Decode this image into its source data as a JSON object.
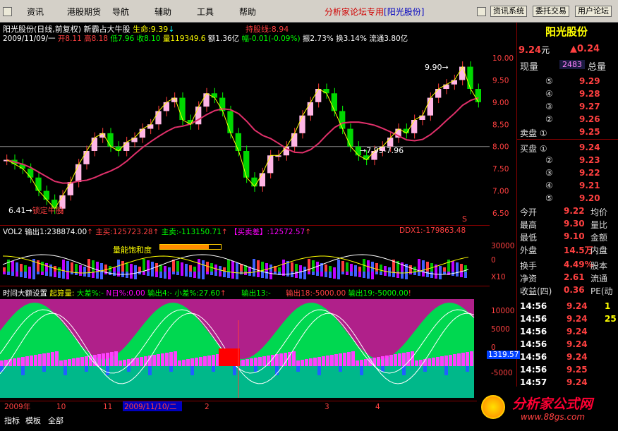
{
  "menu": {
    "items": [
      "资讯",
      "港股期货",
      "导航",
      "辅助",
      "工具",
      "帮助"
    ],
    "banner_main": "分析家论坛专用",
    "banner_stock": "[阳光股份]",
    "sys_buttons": [
      "资讯系统",
      "委托交易",
      "用户论坛"
    ]
  },
  "header": {
    "title": "阳光股份(日线,前复权) 新霸占大牛股",
    "life": "生命:9.39",
    "hold": "持股线:8.94",
    "date": "2009/11/09/一",
    "open_label": "开",
    "open": "8.11",
    "high_label": "高",
    "high": "8.18",
    "low_label": "低",
    "low": "7.96",
    "close_label": "收",
    "close": "8.10",
    "vol_label": "量",
    "vol": "119349.6",
    "amt": "额1.36亿",
    "chg": "幅-0.01(-0.09%)",
    "amp": "振2.73%",
    "turn": "换3.14%",
    "circ": "流通3.80亿"
  },
  "main_chart": {
    "ymin": 6.5,
    "ymax": 10.0,
    "y_ticks": [
      "10.00",
      "9.50",
      "9.00",
      "8.50",
      "8.00",
      "7.50",
      "7.00",
      "6.50"
    ],
    "annotations": {
      "low": "6.41",
      "low_tag": "锁定牛股",
      "high": "9.90",
      "range": "7.95-7.96",
      "s_marker": "S"
    },
    "closes": [
      7.7,
      7.6,
      7.5,
      7.3,
      7.0,
      6.8,
      6.6,
      6.9,
      7.2,
      7.6,
      7.9,
      8.2,
      8.3,
      8.0,
      7.9,
      8.1,
      8.2,
      8.4,
      8.5,
      8.8,
      9.0,
      9.1,
      8.6,
      8.5,
      8.9,
      9.2,
      9.1,
      8.8,
      8.3,
      7.9,
      7.3,
      7.1,
      7.4,
      7.8,
      7.8,
      8.0,
      8.3,
      8.7,
      9.0,
      9.3,
      9.2,
      8.8,
      8.4,
      8.0,
      7.8,
      7.7,
      7.9,
      8.0,
      8.2,
      8.4,
      8.3,
      8.6,
      8.7,
      9.1,
      9.3,
      9.4,
      9.5,
      9.8,
      9.3,
      9.0
    ]
  },
  "vol_panel": {
    "label": "VOL2",
    "out1": "输出1:238874.00",
    "main_buy": "主买:125723.28",
    "main_sell": "主卖:-113150.71",
    "buy_sell_diff": "【买卖差】:12572.57",
    "ddx": "DDX1:-179863.48",
    "sat_label": "量能饱和度",
    "y_ticks": [
      "30000",
      "0",
      "X10"
    ]
  },
  "ind_panel": {
    "title": "时间大额设置",
    "calc": "起算量:",
    "big_diff": "大差%:-",
    "n_diff": "N日%:0.00",
    "out4": "输出4:-",
    "small_diff": "小差%:27.60",
    "out13": "输出13:-",
    "out18": "输出18:-5000.00",
    "out19": "输出19:-5000.00",
    "y_ticks": [
      "10000",
      "5000",
      "0",
      "-5000"
    ],
    "cursor_val": "1319.57"
  },
  "xaxis": {
    "labels": [
      "2009年",
      "10",
      "11",
      "2009/11/10/二",
      "2",
      "3",
      "4"
    ]
  },
  "right_panel": {
    "name": "阳光股份",
    "price": "9.24",
    "price_unit": "元",
    "change": "▲0.24",
    "vol_label": "现量",
    "vol_val": "2483",
    "total_label": "总量",
    "sell": [
      {
        "n": "⑤",
        "p": "9.29"
      },
      {
        "n": "④",
        "p": "9.28"
      },
      {
        "n": "③",
        "p": "9.27"
      },
      {
        "n": "②",
        "p": "9.26"
      },
      {
        "n": "卖盘 ①",
        "p": "9.25"
      }
    ],
    "buy": [
      {
        "n": "买盘 ①",
        "p": "9.24"
      },
      {
        "n": "②",
        "p": "9.23"
      },
      {
        "n": "③",
        "p": "9.22"
      },
      {
        "n": "④",
        "p": "9.21"
      },
      {
        "n": "⑤",
        "p": "9.20"
      }
    ],
    "stats": [
      {
        "l": "今开",
        "v": "9.22",
        "r": "均价"
      },
      {
        "l": "最高",
        "v": "9.30",
        "r": "量比"
      },
      {
        "l": "最低",
        "v": "9.10",
        "r": "金额"
      },
      {
        "l": "外盘",
        "v": "14.5万",
        "r": "内盘"
      }
    ],
    "stats2": [
      {
        "l": "换手",
        "v": "4.49%",
        "r": "股本"
      },
      {
        "l": "净资",
        "v": "2.61",
        "r": "流通"
      },
      {
        "l": "收益(四)",
        "v": "0.36",
        "r": "PE(动"
      }
    ],
    "ticks": [
      {
        "t": "14:56",
        "p": "9.24",
        "x": "1"
      },
      {
        "t": "14:56",
        "p": "9.24",
        "x": "25"
      },
      {
        "t": "14:56",
        "p": "9.24",
        "x": ""
      },
      {
        "t": "14:56",
        "p": "9.24",
        "x": ""
      },
      {
        "t": "14:56",
        "p": "9.24",
        "x": ""
      },
      {
        "t": "14:56",
        "p": "9.25",
        "x": ""
      },
      {
        "t": "14:57",
        "p": "9.24",
        "x": ""
      }
    ]
  },
  "bottom": {
    "tabs": [
      "指标",
      "模板",
      "全部"
    ],
    "logo": "分析家公式网",
    "url": "www.88gs.com"
  }
}
